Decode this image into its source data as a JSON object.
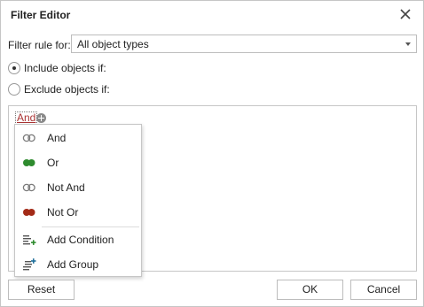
{
  "dialog": {
    "title": "Filter Editor"
  },
  "filter_rule": {
    "label": "Filter rule for:",
    "value": "All object types"
  },
  "options": {
    "include_label": "Include objects if:",
    "exclude_label": "Exclude objects if:",
    "selected": "include"
  },
  "editor": {
    "group_operator": "And"
  },
  "menu": {
    "items": [
      {
        "label": "And",
        "icon": "and-group-icon"
      },
      {
        "label": "Or",
        "icon": "or-group-icon"
      },
      {
        "label": "Not And",
        "icon": "not-and-group-icon"
      },
      {
        "label": "Not Or",
        "icon": "not-or-group-icon"
      },
      {
        "label": "Add Condition",
        "icon": "add-condition-icon"
      },
      {
        "label": "Add Group",
        "icon": "add-group-icon"
      }
    ]
  },
  "buttons": {
    "reset": "Reset",
    "ok": "OK",
    "cancel": "Cancel"
  },
  "colors": {
    "or_green": "#2e8b2e",
    "not_or_red": "#a32a17",
    "link_red": "#aa3333",
    "icon_gray": "#7a7a7a"
  }
}
